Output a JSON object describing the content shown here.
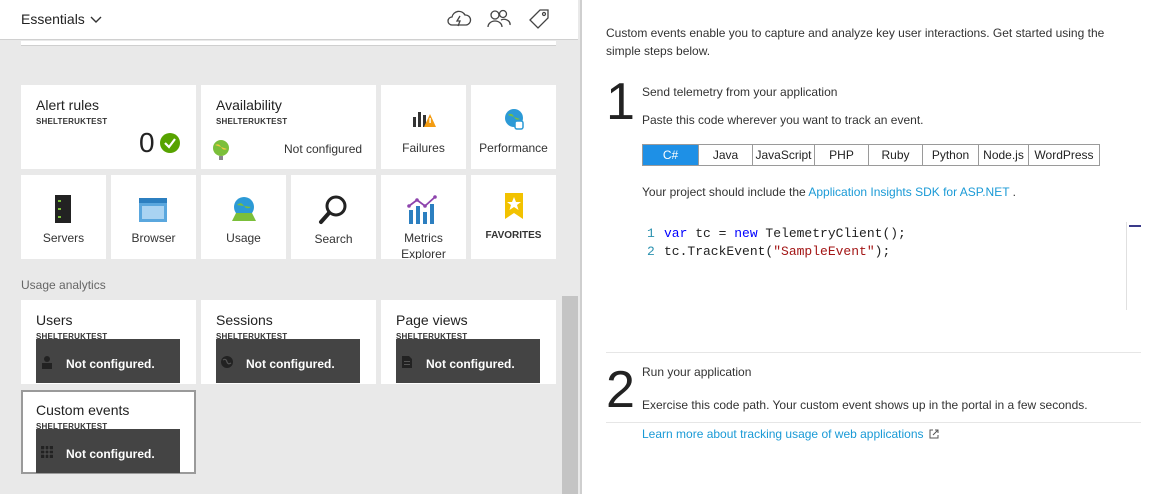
{
  "essentials": {
    "label": "Essentials"
  },
  "top_icons": [
    "cloud-lightning-icon",
    "users-icon",
    "tag-icon"
  ],
  "tiles": {
    "alert_rules": {
      "title": "Alert rules",
      "subtitle": "SHELTERUKTEST",
      "count": "0"
    },
    "availability": {
      "title": "Availability",
      "subtitle": "SHELTERUKTEST",
      "status": "Not configured"
    },
    "failures": {
      "label": "Failures"
    },
    "performance": {
      "label": "Performance"
    },
    "servers": {
      "label": "Servers"
    },
    "browser": {
      "label": "Browser"
    },
    "usage": {
      "label": "Usage"
    },
    "search": {
      "label": "Search"
    },
    "metrics": {
      "label_line1": "Metrics",
      "label_line2": "Explorer"
    },
    "favorites": {
      "label": "FAVORITES"
    }
  },
  "usage_analytics": {
    "heading": "Usage analytics",
    "tiles": [
      {
        "title": "Users",
        "subtitle": "SHELTERUKTEST",
        "status": "Not configured."
      },
      {
        "title": "Sessions",
        "subtitle": "SHELTERUKTEST",
        "status": "Not configured."
      },
      {
        "title": "Page views",
        "subtitle": "SHELTERUKTEST",
        "status": "Not configured."
      },
      {
        "title": "Custom events",
        "subtitle": "SHELTERUKTEST",
        "status": "Not configured."
      }
    ]
  },
  "right": {
    "intro": "Custom events enable you to capture and analyze key user interactions. Get started using the simple steps below.",
    "step1": {
      "number": "1",
      "title": "Send telemetry from your application",
      "desc": "Paste this code wherever you want to track an event.",
      "languages": [
        "C#",
        "Java",
        "JavaScript",
        "PHP",
        "Ruby",
        "Python",
        "Node.js",
        "WordPress"
      ],
      "active_language": "C#",
      "sdk_prefix": "Your project should include the ",
      "sdk_link": "Application Insights SDK for ASP.NET",
      "sdk_suffix": " .",
      "code": {
        "line1_no": "1",
        "line1_kw1": "var",
        "line1_mid": " tc = ",
        "line1_kw2": "new",
        "line1_end": " TelemetryClient();",
        "line2_no": "2",
        "line2_start": "tc.TrackEvent(",
        "line2_str": "\"SampleEvent\"",
        "line2_end": ");"
      }
    },
    "step2": {
      "number": "2",
      "title": "Run your application",
      "desc": "Exercise this code path. Your custom event shows up in the portal in a few seconds."
    },
    "learn_link": "Learn more about tracking usage of web applications"
  },
  "colors": {
    "accent": "#1e90e6",
    "link": "#1a9ad6",
    "ok": "#57a300",
    "overlay": "#444444"
  }
}
